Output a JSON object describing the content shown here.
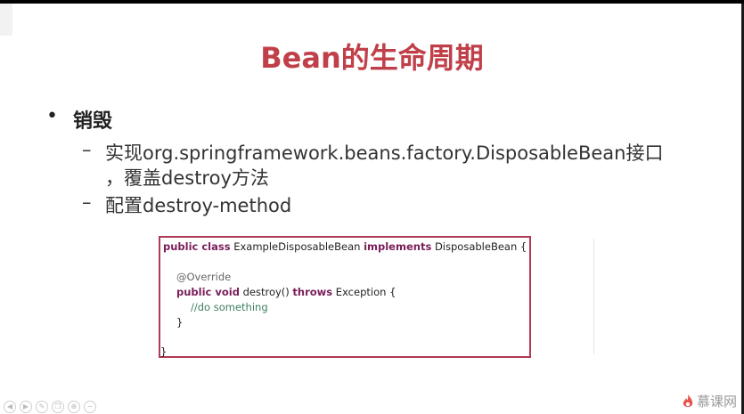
{
  "slide": {
    "title": "Bean的生命周期",
    "bullet": {
      "marker": "•",
      "text": "销毁"
    },
    "subitems": [
      {
        "dash": "–",
        "text": "实现org.springframework.beans.factory.DisposableBean接口",
        "continuation": "，覆盖destroy方法"
      },
      {
        "dash": "–",
        "text": "配置destroy-method"
      }
    ]
  },
  "code": {
    "line1_kw1": "public class",
    "line1_name": " ExampleDisposableBean ",
    "line1_kw2": "implements",
    "line1_rest": " DisposableBean {",
    "annotation": "@Override",
    "line3_kw": "public void",
    "line3_mid": " destroy() ",
    "line3_kw2": "throws",
    "line3_rest": " Exception {",
    "comment": "//do something",
    "close_inner": "}",
    "close_outer": "}"
  },
  "player": {
    "buttons": [
      "prev-icon",
      "next-icon",
      "pen-icon",
      "copy-icon",
      "zoom-icon",
      "minus-icon"
    ]
  },
  "logo": {
    "text": "慕课网",
    "accent": "#e8514a"
  },
  "colors": {
    "title": "#c0404a",
    "code_border": "#b03a55",
    "keyword": "#7a1e5a",
    "comment": "#3f7f5f"
  }
}
